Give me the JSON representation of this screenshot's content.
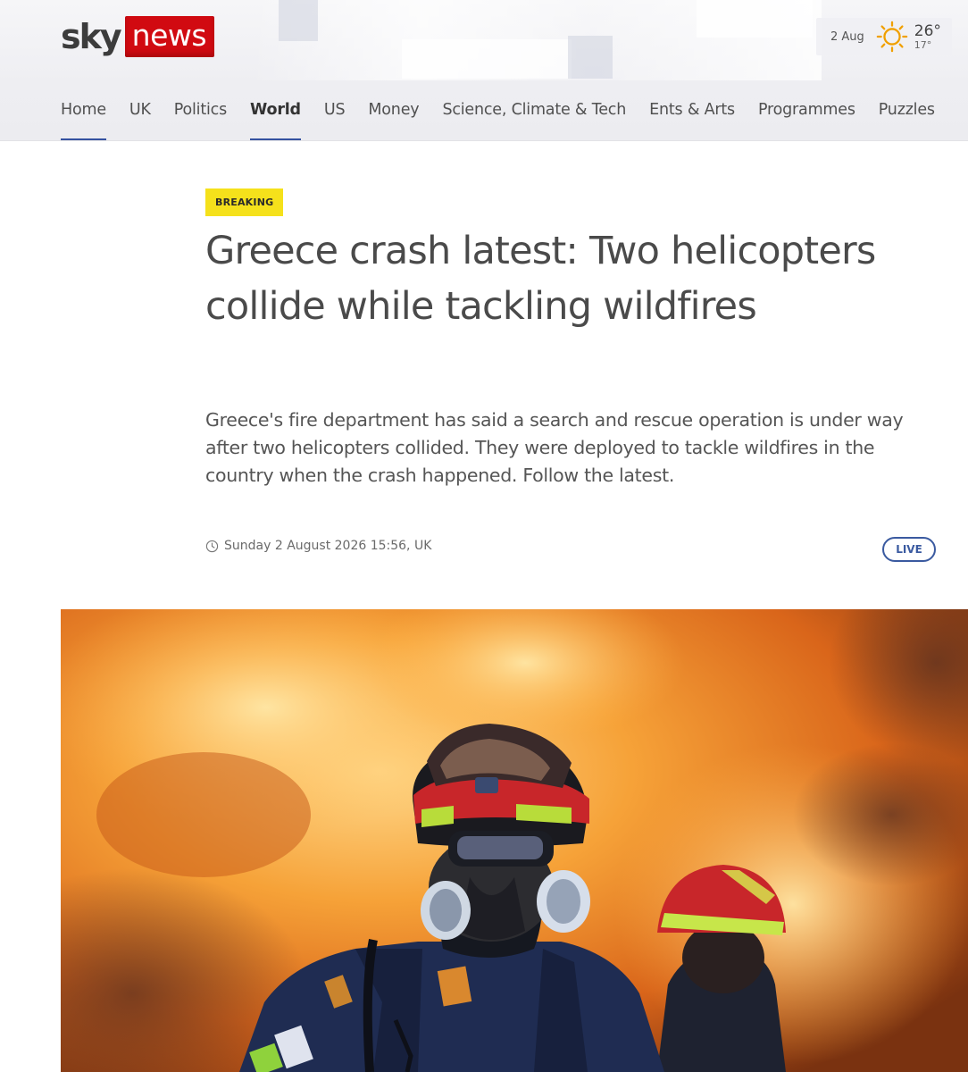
{
  "brand": {
    "sky": "sky",
    "news": "news"
  },
  "weather": {
    "date": "2 Aug",
    "high": "26°",
    "low": "17°",
    "icon": "sun-icon"
  },
  "nav": {
    "items": [
      {
        "label": "Home"
      },
      {
        "label": "UK"
      },
      {
        "label": "Politics"
      },
      {
        "label": "World"
      },
      {
        "label": "US"
      },
      {
        "label": "Money"
      },
      {
        "label": "Science, Climate & Tech"
      },
      {
        "label": "Ents & Arts"
      },
      {
        "label": "Programmes"
      },
      {
        "label": "Puzzles"
      }
    ],
    "active": "World"
  },
  "article": {
    "badge": "BREAKING",
    "headline": "Greece crash latest: Two helicopters collide while tackling wildfires",
    "standfirst": "Greece's fire department has said a search and rescue operation is under way after two helicopters collided. They were deployed to tackle wildfires in the country when the crash happened. Follow the latest.",
    "timestamp": "Sunday 2 August 2026 15:56, UK",
    "live_label": "LIVE"
  },
  "colors": {
    "brand_red": "#d10a11",
    "breaking_yellow": "#f5e11b",
    "nav_underline": "#3552a0",
    "live_blue": "#3a5aa0"
  }
}
